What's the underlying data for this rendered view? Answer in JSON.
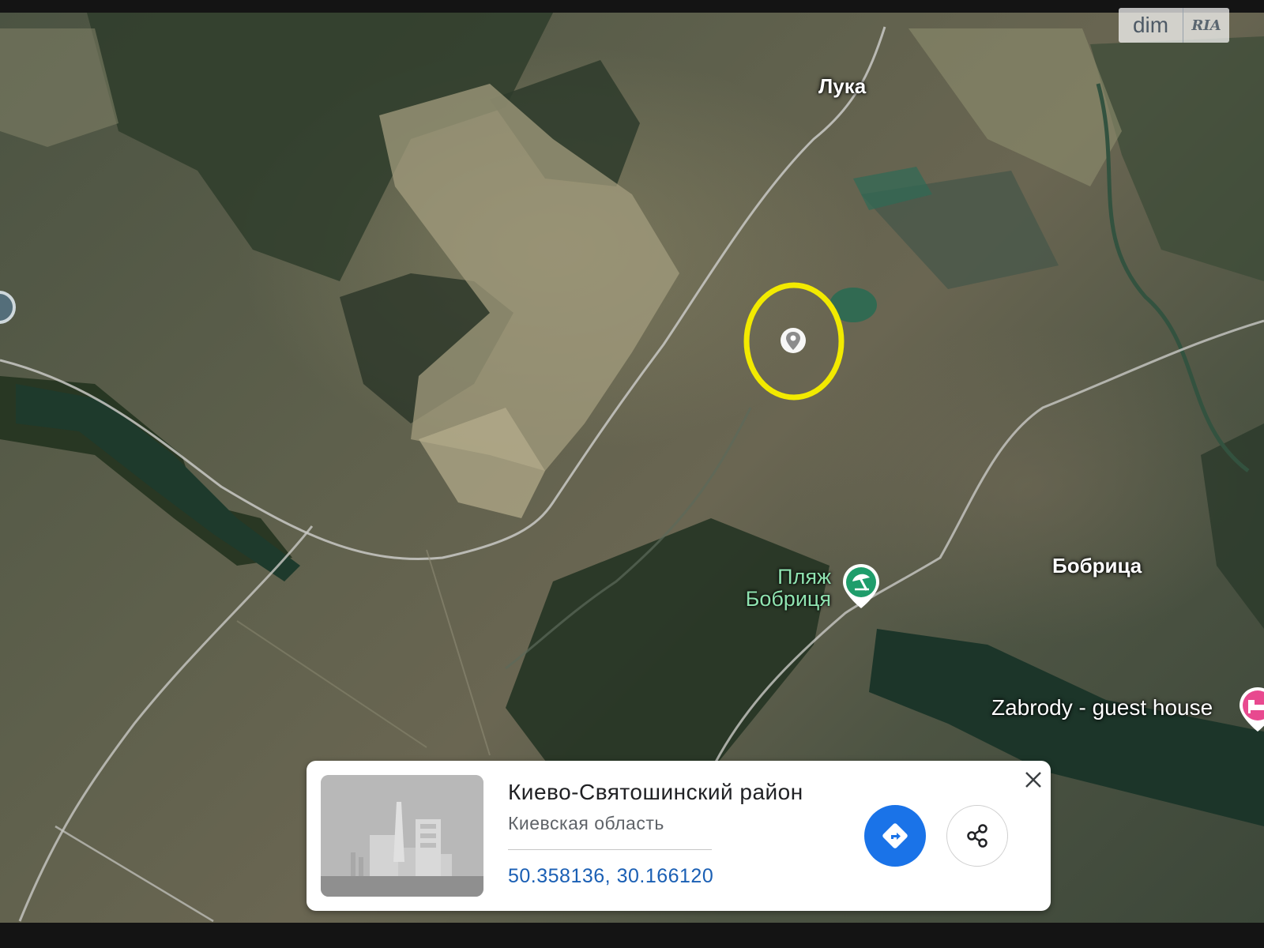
{
  "map": {
    "labels": {
      "luka": "Лука",
      "bobritsa": "Бобрица",
      "beach_line1": "Пляж",
      "beach_line2": "Бобриця",
      "guest_house": "Zabrody - guest house"
    },
    "highlight_color": "#f2ea00",
    "icons": {
      "selected_pin": "location-pin-icon",
      "beach": "beach-umbrella-icon",
      "hotel": "bed-icon"
    }
  },
  "watermark": {
    "text": "dim",
    "logo": "RIA"
  },
  "place_card": {
    "title": "Киево-Святошинский район",
    "subtitle": "Киевская область",
    "coordinates": "50.358136, 30.166120",
    "buttons": {
      "close": "close-icon",
      "directions": "directions-icon",
      "share": "share-icon"
    },
    "accent_color": "#1a73e8"
  }
}
